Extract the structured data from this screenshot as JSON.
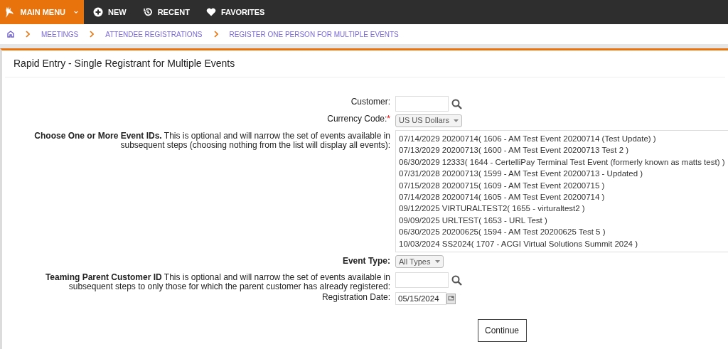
{
  "top_nav": {
    "main_menu": "MAIN MENU",
    "items": [
      {
        "label": "NEW"
      },
      {
        "label": "RECENT"
      },
      {
        "label": "FAVORITES"
      }
    ]
  },
  "breadcrumb": [
    "MEETINGS",
    "ATTENDEE REGISTRATIONS",
    "REGISTER ONE PERSON FOR MULTIPLE EVENTS"
  ],
  "panel": {
    "title": "Rapid Entry - Single Registrant for Multiple Events"
  },
  "form": {
    "customer": {
      "label": "Customer:"
    },
    "currency": {
      "label": "Currency Code:",
      "required_mark": "*",
      "value": "US US Dollars"
    },
    "events": {
      "label": "**Choose One or More Event IDs.** This is optional and will narrow the set of events available in subsequent steps (choosing nothing from the list will display all events):",
      "options": [
        {
          "text": "07/14/2029 20200714( 1606 - AM Test Event 20200714 (Test Update) )",
          "selected": false
        },
        {
          "text": "07/13/2029 20200713( 1600 - AM Test Event 20200713 Test 2 )",
          "selected": false
        },
        {
          "text": "06/30/2029 12333( 1644 - CertelliPay Terminal Test Event (formerly known as matts test) )",
          "selected": false
        },
        {
          "text": "07/31/2028 20200713( 1599 - AM Test Event 20200713 - Updated )",
          "selected": false
        },
        {
          "text": "07/15/2028 20200715( 1609 - AM Test Event 20200715 )",
          "selected": false
        },
        {
          "text": "07/14/2028 20200714( 1605 - AM Test Event 20200714 )",
          "selected": false
        },
        {
          "text": "09/12/2025 VIRTURALTEST2( 1655 - virturaltest2 )",
          "selected": false
        },
        {
          "text": "09/09/2025 URLTEST( 1653 - URL Test )",
          "selected": false
        },
        {
          "text": "06/30/2025 20200625( 1594 - AM Test 20200625 Test 5 )",
          "selected": false
        },
        {
          "text": "10/03/2024 SS2024( 1707 - ACGI Virtual Solutions Summit 2024 )",
          "selected": false
        }
      ]
    },
    "event_type": {
      "label": "Event Type:",
      "value": "All Types"
    },
    "teaming_parent": {
      "label": "**Teaming Parent Customer ID** This is optional and will narrow the set of events available in subsequent steps to only those for which the parent customer has already registered:"
    },
    "registration_date": {
      "label": "Registration Date:",
      "value": "05/15/2024"
    },
    "continue_button": "Continue"
  }
}
